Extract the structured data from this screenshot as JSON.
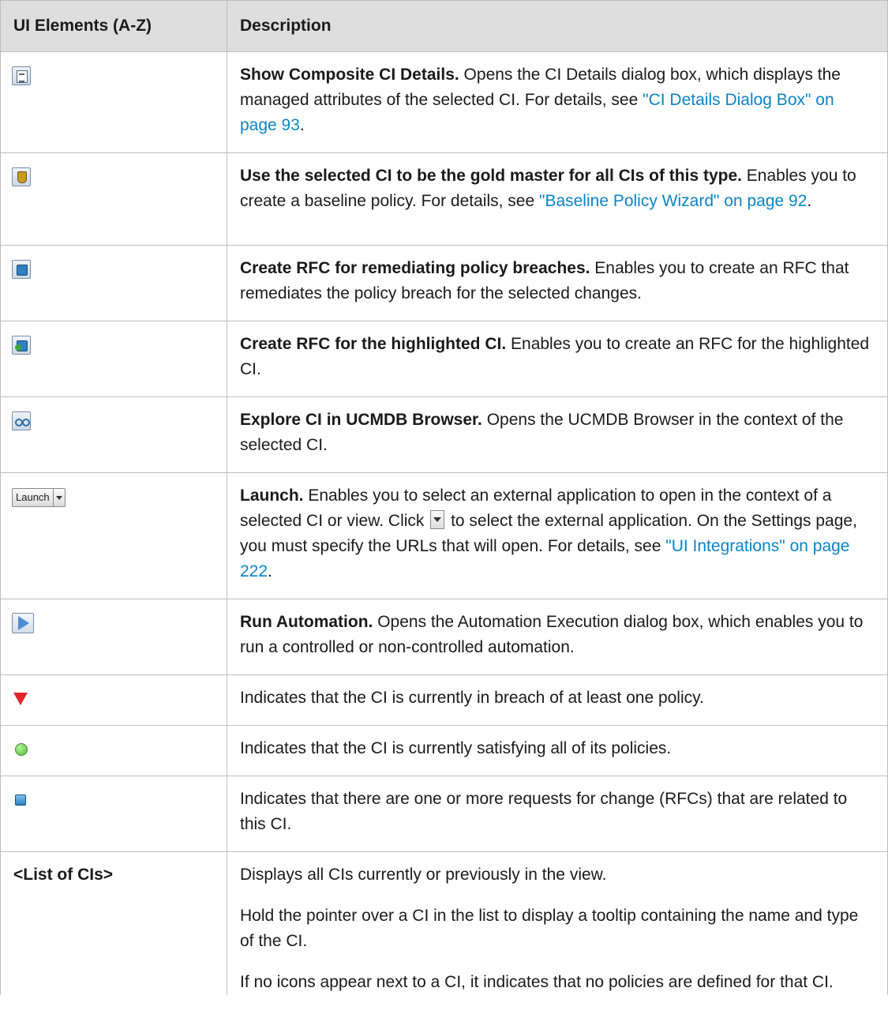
{
  "header": {
    "col1": "UI Elements (A-Z)",
    "col2": "Description"
  },
  "rows": {
    "show_composite": {
      "icon": "show-composite-details-icon",
      "title": "Show Composite CI Details.",
      "text": " Opens the CI Details dialog box, which displays the managed attributes of the selected CI. For details, see ",
      "link": "\"CI Details Dialog Box\" on page 93",
      "tail": "."
    },
    "gold_master": {
      "icon": "gold-master-icon",
      "title": "Use the selected CI to be the gold master for all CIs of this type.",
      "text": " Enables you to create a baseline policy. For details, see ",
      "link": "\"Baseline Policy Wizard\" on page 92",
      "tail": "."
    },
    "rfc_breaches": {
      "icon": "create-rfc-breaches-icon",
      "title": "Create RFC for remediating policy breaches.",
      "text": " Enables you to create an RFC that remediates the policy breach for the selected changes."
    },
    "rfc_highlighted": {
      "icon": "create-rfc-highlighted-icon",
      "title": "Create RFC for the highlighted CI.",
      "text": " Enables you to create an RFC for the highlighted CI."
    },
    "explore": {
      "icon": "explore-browser-icon",
      "title": "Explore CI in UCMDB Browser.",
      "text": " Opens the UCMDB Browser in the context of the selected CI."
    },
    "launch": {
      "icon_label": "Launch",
      "title": "Launch.",
      "text1": " Enables you to select an external application to open in the context of a selected CI or view. Click ",
      "text2": " to select the external application. On the Settings page, you must specify the URLs that will open. For details, see ",
      "link": "\"UI Integrations\" on page 222",
      "tail": "."
    },
    "run_automation": {
      "icon": "run-automation-icon",
      "title": "Run Automation.",
      "text": " Opens the Automation Execution dialog box, which enables you to run a controlled or non-controlled automation."
    },
    "breach": {
      "icon": "breach-triangle-icon",
      "text": "Indicates that the CI is currently in breach of at least one policy."
    },
    "satisfying": {
      "icon": "satisfied-dot-icon",
      "text": "Indicates that the CI is currently satisfying all of its policies."
    },
    "rfcs": {
      "icon": "rfc-cube-icon",
      "text": "Indicates that there are one or more requests for change (RFCs) that are related to this CI."
    },
    "list": {
      "label": "<List of CIs>",
      "p1": "Displays all CIs currently or previously in the view.",
      "p2": "Hold the pointer over a CI in the list to display a tooltip containing the name and type of the CI.",
      "p3": "If no icons appear next to a CI, it indicates that no policies are defined for that CI."
    }
  },
  "colors": {
    "header_bg": "#dedede",
    "border": "#bdbdbd",
    "link": "#0a84c6"
  }
}
